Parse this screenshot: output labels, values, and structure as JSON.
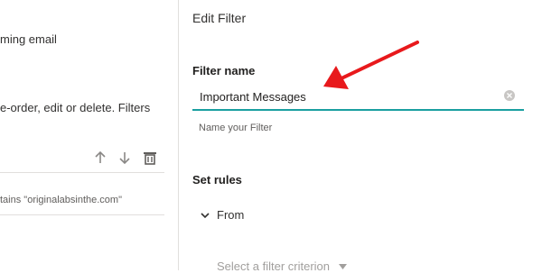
{
  "left_panel": {
    "line1": "ming email",
    "line2": "e-order, edit or delete. Filters",
    "rule_condition": "tains \"originalabsinthe.com\"",
    "move_up_label": "Move up",
    "move_down_label": "Move down",
    "delete_label": "Delete"
  },
  "edit_filter": {
    "title": "Edit Filter",
    "filter_name_label": "Filter name",
    "filter_name_value": "Important Messages",
    "filter_name_helper": "Name your Filter",
    "set_rules_label": "Set rules",
    "from_label": "From",
    "criterion_placeholder": "Select a filter criterion"
  },
  "colors": {
    "accent": "#1a9fa0",
    "annotation_arrow": "#e8191c"
  },
  "icons": {
    "up": "arrow-up-icon",
    "down": "arrow-down-icon",
    "delete": "trash-icon",
    "clear": "clear-circle-icon",
    "expand": "chevron-down-icon"
  }
}
